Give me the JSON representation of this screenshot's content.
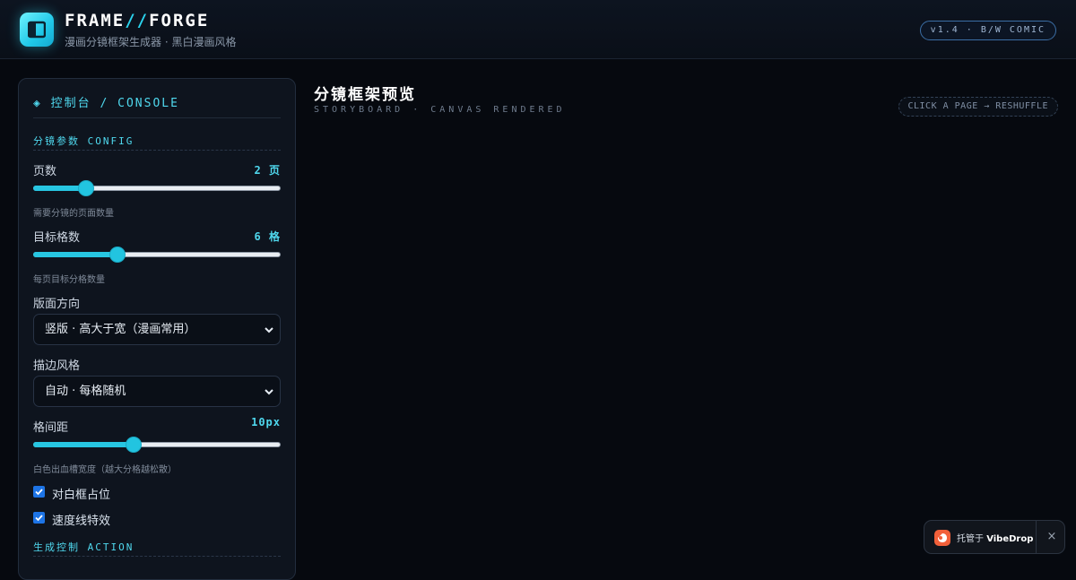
{
  "header": {
    "brand_left": "FRAME",
    "brand_sep": "//",
    "brand_right": "FORGE",
    "tagline": "漫画分镜框架生成器 · 黑白漫画风格",
    "version": "v1.4 · B/W COMIC",
    "logo_icon": "panel-layout-icon"
  },
  "console": {
    "title": "◈ 控制台 / CONSOLE",
    "config_heading": "分镜参数 CONFIG",
    "pages": {
      "label": "页数",
      "value": "2 页",
      "hint": "需要分镜的页面数量",
      "fill_fraction": 0.215
    },
    "panels": {
      "label": "目标格数",
      "value": "6 格",
      "hint": "每页目标分格数量",
      "fill_fraction": 0.34
    },
    "orientation": {
      "label": "版面方向",
      "selected": "竖版 · 高大于宽（漫画常用）"
    },
    "stroke": {
      "label": "描边风格",
      "selected": "自动 · 每格随机"
    },
    "gutter": {
      "label": "格间距",
      "value": "10px",
      "hint": "白色出血槽宽度（越大分格越松散）",
      "fill_fraction": 0.405
    },
    "checks": [
      {
        "label": "对白框占位",
        "checked": true
      },
      {
        "label": "速度线特效",
        "checked": true
      }
    ],
    "action_heading": "生成控制 ACTION"
  },
  "preview": {
    "title": "分镜框架预览",
    "subtitle": "STORYBOARD · CANVAS RENDERED",
    "reshuffle": "CLICK A PAGE → RESHUFFLE"
  },
  "hosted": {
    "prefix": "托管于",
    "brand": "VibeDrop",
    "close": "×"
  },
  "colors": {
    "accent": "#2bd4ee",
    "background": "#06090f",
    "panel": "#0e141e",
    "checkbox": "#1d74e6",
    "hosted_logo": "#f2603a"
  }
}
